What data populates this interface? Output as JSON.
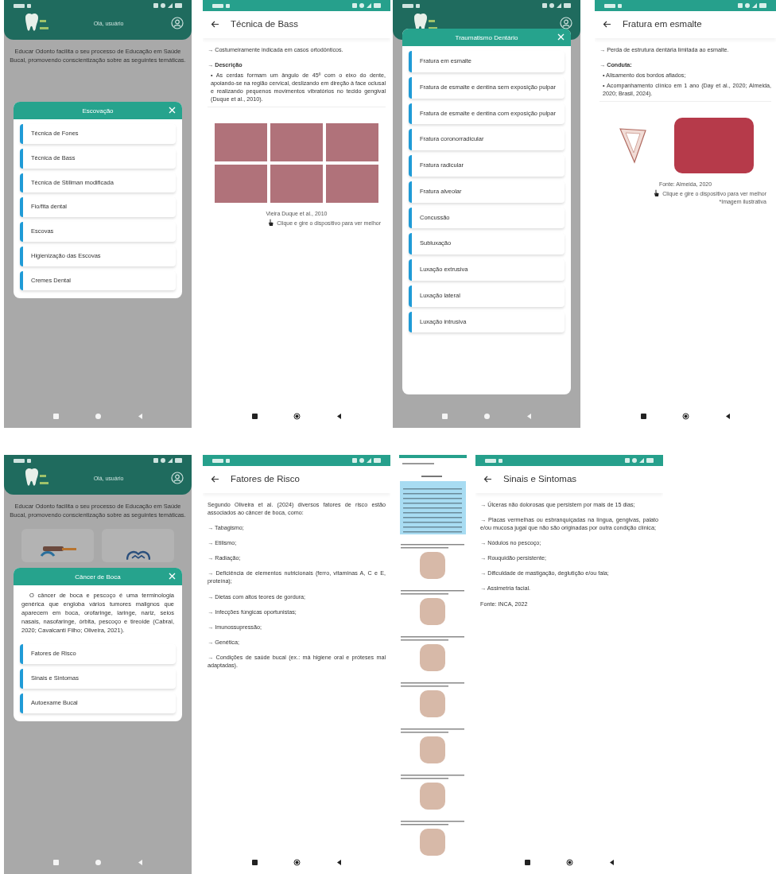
{
  "rows": [
    [
      {
        "kind": "menu",
        "greeting": "Olá, usuário",
        "intro": "Educar Odonto facilita o seu processo de Educação em Saúde Bucal, promovendo conscientização sobre as seguintes temáticas.",
        "topic_cards": false,
        "modal": {
          "title": "Escovação",
          "items": [
            "Técnica de Fones",
            "Técnica de Bass",
            "Técnica de Stillman modificada",
            "Fio/fita dental",
            "Escovas",
            "Higienização das Escovas",
            "Cremes Dental"
          ]
        }
      },
      {
        "kind": "detail",
        "title": "Técnica de Bass",
        "blocks": [
          {
            "kind": "paragraph",
            "text": "→ Costumeiramente indicada em casos ortodônticos."
          },
          {
            "kind": "heading",
            "text": "→ Descrição"
          },
          {
            "kind": "bullet",
            "text": "• As cerdas formam um ângulo de 45º com o eixo do dente, apoiando-se na região cervical, deslizando em direção à face oclusal e realizando pequenos movimentos vibratórios no tecido gengival (Duque et al., 2010)."
          }
        ],
        "figure": {
          "kind": "photo_grid",
          "caption": "Vieira Duque et al., 2010",
          "hint": "Clique e gire o dispositivo para ver melhor"
        }
      },
      {
        "kind": "menu",
        "topic_cards": false,
        "modal": {
          "title": "Traumatismo Dentário",
          "items": [
            "Fratura em esmalte",
            "Fratura de esmalte e dentina sem exposição pulpar",
            "Fratura de esmalte e dentina com exposição pulpar",
            "Fratura coronorradicular",
            "Fratura radicular",
            "Fratura alveolar",
            "Concussão",
            "Subluxação",
            "Luxação extrusiva",
            "Luxação lateral",
            "Luxação intrusiva"
          ]
        }
      },
      {
        "kind": "detail",
        "title": "Fratura em esmalte",
        "blocks": [
          {
            "kind": "paragraph",
            "text": "→ Perda de estrutura dentária limitada ao esmalte."
          },
          {
            "kind": "heading",
            "text": "→ Conduta:"
          },
          {
            "kind": "bullet",
            "text": "• Alisamento dos bordos afiados;"
          },
          {
            "kind": "bullet",
            "text": "• Acompanhamento clínico em 1 ano (Day et al., 2020; Almeida, 2020; Brasil, 2024)."
          }
        ],
        "figure": {
          "kind": "illustration_pair",
          "caption": "Fonte: Almeida, 2020",
          "hint": "Clique e gire o dispositivo para ver melhor",
          "note": "*Imagem ilustrativa"
        }
      }
    ],
    [
      {
        "kind": "menu",
        "greeting": "Olá, usuário",
        "intro": "Educar Odonto facilita o seu processo de Educação em Saúde Bucal, promovendo conscientização sobre as seguintes temáticas.",
        "topic_cards": true,
        "modal": {
          "title": "Câncer de Boca",
          "text": "O câncer de boca e pescoço é uma terminologia genérica que engloba vários tumores malignos que aparecem em boca, orofaringe, laringe, nariz, seios nasais, nasofaringe, órbita, pescoço e tireoide (Cabral, 2020; Cavalcanti Filho; Oliveira, 2021).",
          "items": [
            "Fatores de Risco",
            "Sinais e Sintomas",
            "Autoexame Bucal"
          ]
        }
      },
      {
        "kind": "detail",
        "title": "Fatores de Risco",
        "blocks": [
          {
            "kind": "paragraph",
            "text": "Segundo Oliveira et al. (2024) diversos fatores de risco estão associados ao câncer de boca, como:"
          },
          {
            "kind": "paragraph",
            "text": "→ Tabagismo;"
          },
          {
            "kind": "paragraph",
            "text": "→ Etilismo;"
          },
          {
            "kind": "paragraph",
            "text": "→ Radiação;"
          },
          {
            "kind": "paragraph",
            "text": "→ Deficiência de elementos nutricionais (ferro, vitaminas A, C e E, proteína);"
          },
          {
            "kind": "paragraph",
            "text": "→ Dietas com altos teores de gordura;"
          },
          {
            "kind": "paragraph",
            "text": "→ Infecções fúngicas oportunistas;"
          },
          {
            "kind": "paragraph",
            "text": "→ Imunossupressão;"
          },
          {
            "kind": "paragraph",
            "text": "→ Genética;"
          },
          {
            "kind": "paragraph",
            "text": "→ Condições de saúde bucal (ex.: má higiene oral e próteses mal adaptadas)."
          }
        ]
      },
      {
        "kind": "long_capture"
      },
      {
        "kind": "detail",
        "title": "Sinais e Sintomas",
        "blocks": [
          {
            "kind": "paragraph",
            "text": "→ Úlceras não dolorosas que persistem por mais de 15 dias;"
          },
          {
            "kind": "paragraph",
            "text": "→ Placas vermelhas ou esbranquiçadas na língua, gengivas, palato e/ou mucosa jugal que não são originadas por outra condição clínica;"
          },
          {
            "kind": "paragraph",
            "text": "→ Nódulos no pescoço;"
          },
          {
            "kind": "paragraph",
            "text": "→ Rouquidão persistente;"
          },
          {
            "kind": "paragraph",
            "text": "→ Dificuldade de mastigação, deglutição e/ou fala;"
          },
          {
            "kind": "paragraph",
            "text": "→ Assimetria facial."
          },
          {
            "kind": "paragraph",
            "text": "Fonte: INCA, 2022"
          }
        ]
      }
    ]
  ]
}
